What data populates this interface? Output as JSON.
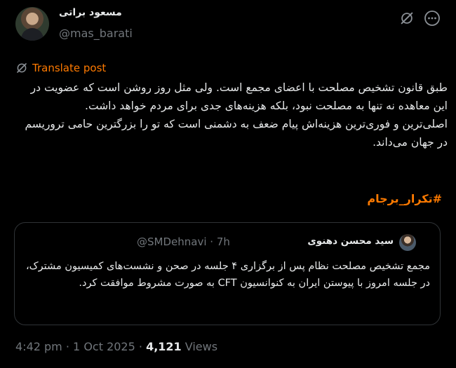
{
  "author": {
    "display_name": "مسعود براتی",
    "handle": "@mas_barati"
  },
  "icons": {
    "grok": "grok-icon",
    "more": "more-options-icon",
    "translate": "translate-icon"
  },
  "translate": {
    "label": "Translate post"
  },
  "post": {
    "paragraph1": "طبق قانون تشخیص مصلحت با اعضای مجمع است. ولی مثل روز روشن است که عضویت در این معاهده نه تنها به مصلحت نبود، بلکه هزینه‌های جدی برای مردم خواهد داشت.",
    "paragraph2": "اصلی‌ترین و فوری‌ترین هزینه‌اش پیام ضعف به دشمنی است که تو را بزرگترین حامی تروریسم در جهان می‌داند.",
    "hashtag": "#تکرار_برجام"
  },
  "quote": {
    "display_name": "سید محسن دهنوی",
    "handle": "@SMDehnavi",
    "separator": "·",
    "time": "7h",
    "text": "مجمع تشخیص مصلحت نظام پس از  برگزاری ۴ جلسه در صحن و نشست‌های کمیسیون مشترک، در جلسه امروز با پیوستن ایران به کنوانسیون CFT به صورت مشروط موافقت کرد."
  },
  "footer": {
    "time": "4:42 pm",
    "sep1": "·",
    "date": "1 Oct 2025",
    "sep2": "·",
    "views_count": "4,121",
    "views_label": "Views"
  },
  "colors": {
    "background": "#000000",
    "text": "#e7e9ea",
    "secondary": "#71767b",
    "accent": "#ff7a00",
    "border": "#2f3336"
  }
}
